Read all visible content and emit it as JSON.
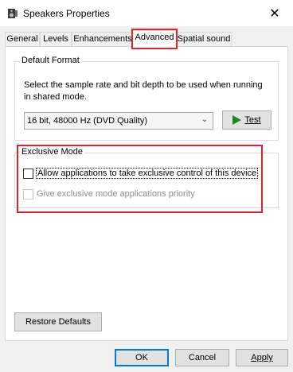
{
  "window": {
    "title": "Speakers Properties",
    "icon": "speaker-icon"
  },
  "tabs": [
    {
      "label": "General",
      "active": false
    },
    {
      "label": "Levels",
      "active": false
    },
    {
      "label": "Enhancements",
      "active": false
    },
    {
      "label": "Advanced",
      "active": true
    },
    {
      "label": "Spatial sound",
      "active": false
    }
  ],
  "default_format": {
    "legend": "Default Format",
    "description": "Select the sample rate and bit depth to be used when running in shared mode.",
    "selected": "16 bit, 48000 Hz (DVD Quality)",
    "test_label": "Test"
  },
  "exclusive_mode": {
    "legend": "Exclusive Mode",
    "allow_label": "Allow applications to take exclusive control of this device",
    "allow_checked": false,
    "priority_label": "Give exclusive mode applications priority",
    "priority_checked": false,
    "priority_enabled": false
  },
  "restore_label": "Restore Defaults",
  "footer": {
    "ok": "OK",
    "cancel": "Cancel",
    "apply": "Apply"
  },
  "highlight_color": "#d9262c"
}
